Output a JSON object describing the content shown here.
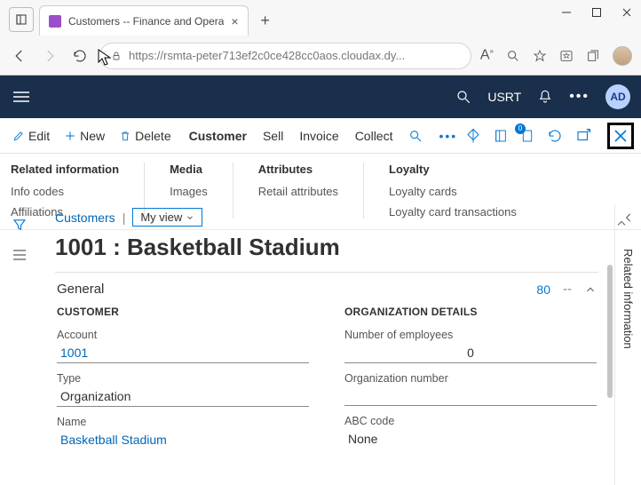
{
  "browser": {
    "tab_title": "Customers -- Finance and Opera",
    "url": "https://rsmta-peter713ef2c0ce428cc0aos.cloudax.dy..."
  },
  "app_header": {
    "company": "USRT",
    "avatar": "AD"
  },
  "action_bar": {
    "edit": "Edit",
    "new": "New",
    "delete": "Delete",
    "tabs": [
      "Customer",
      "Sell",
      "Invoice",
      "Collect"
    ],
    "active_tab": "Customer"
  },
  "ribbon": {
    "g1": {
      "title": "Related information",
      "items": [
        "Info codes",
        "Affiliations"
      ]
    },
    "g2": {
      "title": "Media",
      "items": [
        "Images"
      ]
    },
    "g3": {
      "title": "Attributes",
      "items": [
        "Retail attributes"
      ]
    },
    "g4": {
      "title": "Loyalty",
      "items": [
        "Loyalty cards",
        "Loyalty card transactions"
      ]
    }
  },
  "form": {
    "breadcrumb": "Customers",
    "view": "My view",
    "title": "1001 : Basketball Stadium",
    "section": {
      "name": "General",
      "count": "80",
      "dash": "--"
    },
    "left": {
      "group": "CUSTOMER",
      "account_label": "Account",
      "account_value": "1001",
      "type_label": "Type",
      "type_value": "Organization",
      "name_label": "Name",
      "name_value": "Basketball Stadium"
    },
    "right": {
      "group": "ORGANIZATION DETAILS",
      "emp_label": "Number of employees",
      "emp_value": "0",
      "orgnum_label": "Organization number",
      "orgnum_value": "",
      "abc_label": "ABC code",
      "abc_value": "None"
    }
  },
  "right_rail": {
    "label": "Related information"
  }
}
